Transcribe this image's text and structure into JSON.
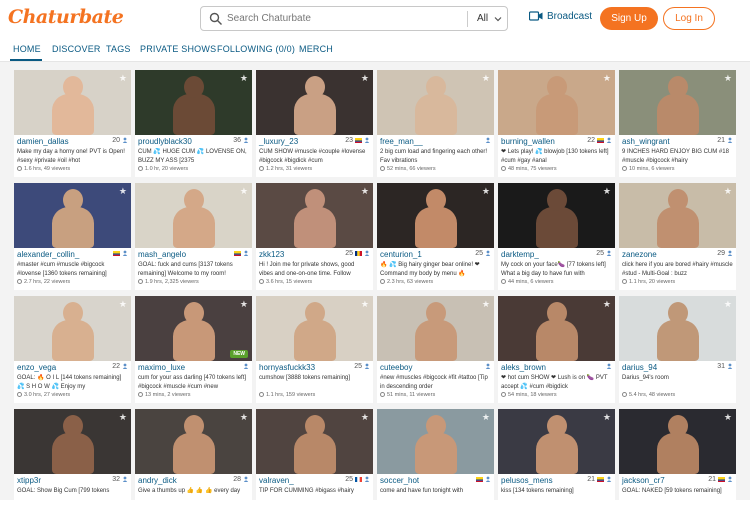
{
  "header": {
    "logo": "Chaturbate",
    "search_placeholder": "Search Chaturbate",
    "filter_value": "All",
    "broadcast_label": "Broadcast",
    "signup_label": "Sign Up",
    "login_label": "Log In"
  },
  "nav": {
    "tabs": [
      "HOME",
      "DISCOVER",
      "TAGS",
      "PRIVATE SHOWS",
      "FOLLOWING (0/0)",
      "MERCH"
    ]
  },
  "colors": {
    "brand": "#f47321",
    "link": "#0a5a83",
    "new_badge": "#5aa02c"
  },
  "rooms": [
    {
      "name": "damien_dallas",
      "age": "20",
      "subject": "Make my day a horny one! PVT is Open! #sexy #private #oil #hot",
      "stats": "1.6 hrs, 49 viewers",
      "flag": "",
      "bg": "#d7d2c8",
      "skin": "#e2b89a",
      "new": false
    },
    {
      "name": "proudlyblack30",
      "age": "36",
      "subject": "CUM 💦 HUGE CUM 💦 LOVENSE ON, BUZZ MY ASS [2375",
      "stats": "1.0 hr, 20 viewers",
      "flag": "",
      "bg": "#2e3a2a",
      "skin": "#6b4a36",
      "new": false
    },
    {
      "name": "_luxury_23",
      "age": "23",
      "subject": "CUM SHOW #muscle #couple #lovense #bigcock #bigdick #cum",
      "stats": "1.2 hrs, 31 viewers",
      "flag": "co",
      "bg": "#3a3230",
      "skin": "#c9a084",
      "new": false
    },
    {
      "name": "free_man__",
      "age": "",
      "subject": "2 big cum load and fingering each other! Fav vibrations",
      "stats": "52 mins, 66 viewers",
      "flag": "",
      "bg": "#cfc4b4",
      "skin": "#d8b89c",
      "new": false
    },
    {
      "name": "burning_wallen",
      "age": "22",
      "subject": "❤ Lets play! 💦 blowjob [130 tokens left] #cum #gay #anal",
      "stats": "48 mins, 75 viewers",
      "flag": "co",
      "bg": "#c9a88a",
      "skin": "#c89a78",
      "new": false
    },
    {
      "name": "ash_wingrant",
      "age": "21",
      "subject": "9 INCHES HARD ENJOY BIG CUM #18 #muscle #bigcock #hairy",
      "stats": "10 mins, 6 viewers",
      "flag": "",
      "bg": "#8a8f7a",
      "skin": "#b98a6a",
      "new": false
    },
    {
      "name": "alexander_collin_",
      "age": "",
      "subject": "#master #cum #muscle #bigcock #lovense [1360 tokens remaining]",
      "stats": "2.7 hrs, 22 viewers",
      "flag": "co",
      "bg": "#3d4a7a",
      "skin": "#c8a080",
      "new": false
    },
    {
      "name": "mash_angelo",
      "age": "",
      "subject": "GOAL: fuck and cums [3137 tokens remaining] Welcome to my room!",
      "stats": "1.9 hrs, 2,325 viewers",
      "flag": "co",
      "bg": "#d9d4c8",
      "skin": "#d4a888",
      "new": false
    },
    {
      "name": "zkk123",
      "age": "25",
      "subject": "Hi ! Join me for private shows, good vibes and one-on-one time. Follow",
      "stats": "3.6 hrs, 15 viewers",
      "flag": "ro",
      "bg": "#5a4a44",
      "skin": "#c0907a",
      "new": false
    },
    {
      "name": "centurion_1",
      "age": "25",
      "subject": "🔥 💦 Big hairy ginger bear online! ❤ Command my body by menu 🔥",
      "stats": "2.3 hrs, 63 viewers",
      "flag": "",
      "bg": "#2c2624",
      "skin": "#c28a68",
      "new": false
    },
    {
      "name": "darktemp_",
      "age": "25",
      "subject": "My cock on your face🍆 [77 tokens left] What a big day to have fun with",
      "stats": "44 mins, 6 viewers",
      "flag": "",
      "bg": "#1a1a1a",
      "skin": "#6b4a38",
      "new": false
    },
    {
      "name": "zanezone",
      "age": "29",
      "subject": "click here if you are bored #hairy #muscle #stud - Multi-Goal : buzz",
      "stats": "1.1 hrs, 20 viewers",
      "flag": "",
      "bg": "#c8bca8",
      "skin": "#c09070",
      "new": false
    },
    {
      "name": "enzo_vega",
      "age": "22",
      "subject": "GOAL: 🔥 O I L [144 tokens remaining] 💦 S H O W 💦 Enjoy my",
      "stats": "3.0 hrs, 27 viewers",
      "flag": "",
      "bg": "#d8d4cc",
      "skin": "#d8b090",
      "new": false
    },
    {
      "name": "maximo_luxe",
      "age": "",
      "subject": "cum for your ass darling [470 tokens left] #bigcock #muscle #cum #new",
      "stats": "13 mins, 2 viewers",
      "flag": "",
      "bg": "#4a4040",
      "skin": "#c89878",
      "new": true
    },
    {
      "name": "hornyasfuckk33",
      "age": "25",
      "subject": "cumshow [3888 tokens remaining]",
      "stats": "1.1 hrs, 159 viewers",
      "flag": "",
      "bg": "#d8d0c4",
      "skin": "#d0a888",
      "new": false
    },
    {
      "name": "cuteeboy",
      "age": "",
      "subject": "#new #muscles #bigcock #fit #tattoo [Tip in descending order",
      "stats": "51 mins, 11 viewers",
      "flag": "",
      "bg": "#c8c0b4",
      "skin": "#c89a7a",
      "new": false
    },
    {
      "name": "aleks_brown",
      "age": "",
      "subject": "❤ hot cum SHOW ❤ Lush is on 🍆 PVT accept 💦 #cum #bigdick",
      "stats": "54 mins, 18 viewers",
      "flag": "",
      "bg": "#4a3a36",
      "skin": "#b88868",
      "new": false
    },
    {
      "name": "darius_94",
      "age": "31",
      "subject": "Darius_94's room",
      "stats": "5.4 hrs, 48 viewers",
      "flag": "",
      "bg": "#d8dcdc",
      "skin": "#c09878",
      "new": false
    },
    {
      "name": "xtipp3r",
      "age": "32",
      "subject": "GOAL: Show Big Cum [799 tokens",
      "stats": "",
      "flag": "",
      "bg": "#3a3634",
      "skin": "#8a6048",
      "new": false
    },
    {
      "name": "andry_dick",
      "age": "28",
      "subject": "Give a thumbs up 👍 👍 👍 every day",
      "stats": "",
      "flag": "",
      "bg": "#4a4440",
      "skin": "#c09070",
      "new": false
    },
    {
      "name": "valraven_",
      "age": "25",
      "subject": "TIP FOR CUMMING #bigass #hairy",
      "stats": "",
      "flag": "fr",
      "bg": "#504440",
      "skin": "#b88868",
      "new": false
    },
    {
      "name": "soccer_hot",
      "age": "",
      "subject": "come and have fun tonight with",
      "stats": "",
      "flag": "co",
      "bg": "#8a9aa0",
      "skin": "#c89878",
      "new": false
    },
    {
      "name": "pelusos_mens",
      "age": "21",
      "subject": "kiss [134 tokens remaining]",
      "stats": "",
      "flag": "co",
      "bg": "#3a3a44",
      "skin": "#c09070",
      "new": false
    },
    {
      "name": "jackson_cr7",
      "age": "21",
      "subject": "GOAL: NAKED [59 tokens remaining]",
      "stats": "",
      "flag": "co",
      "bg": "#2a2a30",
      "skin": "#b08060",
      "new": false
    }
  ]
}
